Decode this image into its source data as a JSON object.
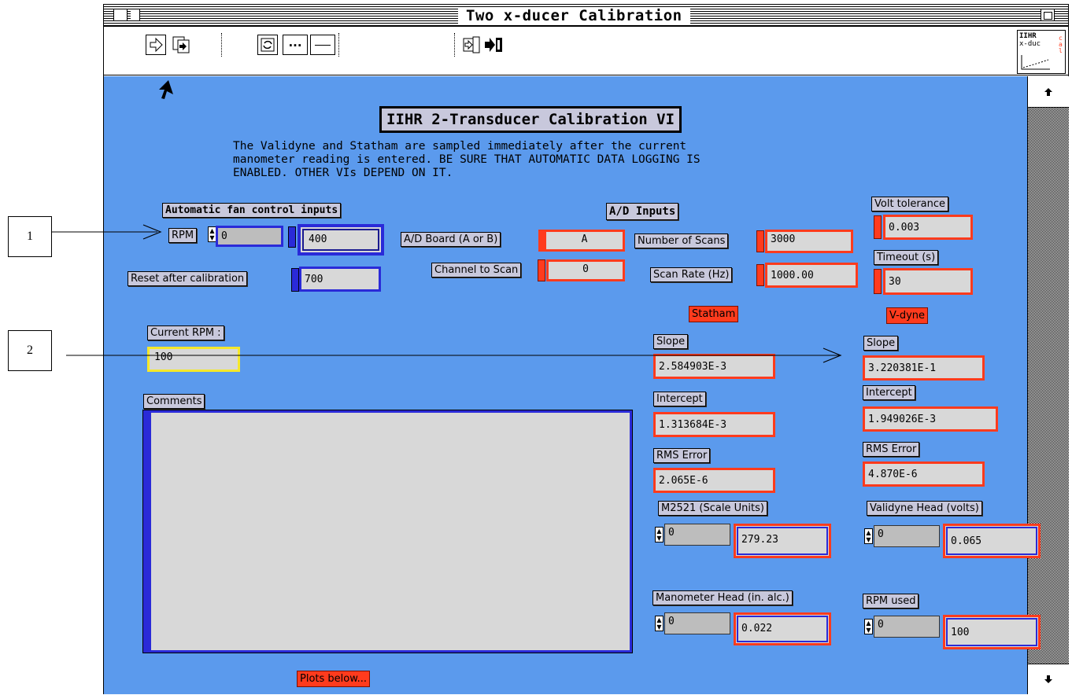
{
  "window": {
    "title": "Two x-ducer Calibration"
  },
  "icon": {
    "lines": [
      "IIHR",
      "x-duc",
      "cal"
    ]
  },
  "callouts": [
    "1",
    "2"
  ],
  "panel": {
    "heading": "IIHR 2-Transducer Calibration VI",
    "description": [
      "The Validyne and Statham are sampled immediately after the current",
      "manometer reading is entered.  BE SURE THAT AUTOMATIC DATA LOGGING IS",
      "ENABLED.  OTHER VIs DEPEND ON IT."
    ],
    "fan": {
      "header": "Automatic fan control inputs",
      "rpm_label": "RPM",
      "rpm_control": "0",
      "rpm_value": "400",
      "reset_label": "Reset after calibration",
      "reset_value": "700"
    },
    "ad": {
      "header": "A/D Inputs",
      "board_label": "A/D Board (A or B)",
      "board_value": "A",
      "channel_label": "Channel to Scan",
      "channel_value": "0",
      "scans_label": "Number of Scans",
      "scans_value": "3000",
      "rate_label": "Scan Rate (Hz)",
      "rate_value": "1000.00"
    },
    "volt_tol": {
      "label": "Volt tolerance",
      "value": "0.003"
    },
    "timeout": {
      "label": "Timeout (s)",
      "value": "30"
    },
    "current_rpm": {
      "label": "Current RPM :",
      "value": "100"
    },
    "comments": {
      "label": "Comments",
      "value": ""
    },
    "plots_button": "Plots below...",
    "statham": {
      "label": "Statham",
      "slope_label": "Slope",
      "slope": "2.584903E-3",
      "intercept_label": "Intercept",
      "intercept": "1.313684E-3",
      "rms_label": "RMS Error",
      "rms": "2.065E-6",
      "m2521_label": "M2521 (Scale Units)",
      "m2521_control": "0",
      "m2521_value": "279.23",
      "manometer_label": "Manometer Head (in. alc.)",
      "manometer_control": "0",
      "manometer_value": "0.022"
    },
    "vdyne": {
      "label": "V-dyne",
      "slope_label": "Slope",
      "slope": "3.220381E-1",
      "intercept_label": "Intercept",
      "intercept": "1.949026E-3",
      "rms_label": "RMS Error",
      "rms": "4.870E-6",
      "validyne_label": "Validyne Head (volts)",
      "validyne_control": "0",
      "validyne_value": "0.065",
      "rpm_used_label": "RPM used",
      "rpm_used_control": "0",
      "rpm_used_value": "100"
    }
  }
}
